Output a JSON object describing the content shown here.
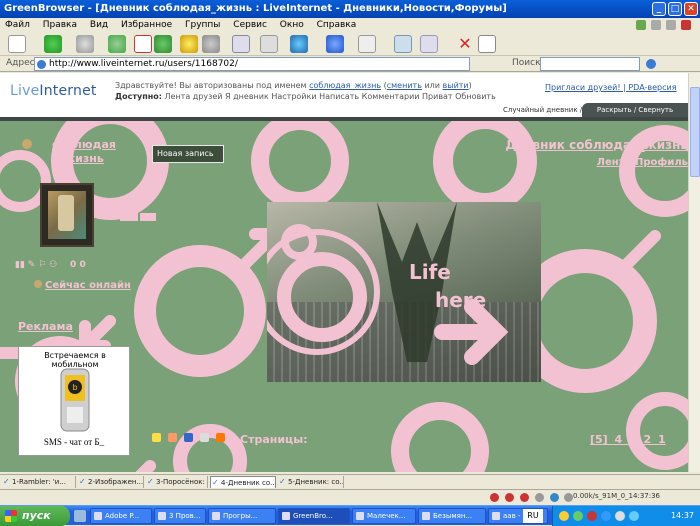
{
  "window": {
    "title": "GreenBrowser - [Дневник соблюдая_жизнь : LiveInternet - Дневники,Новости,Форумы]"
  },
  "menu": {
    "items": [
      "Файл",
      "Правка",
      "Вид",
      "Избранное",
      "Группы",
      "Сервис",
      "Окно",
      "Справка"
    ]
  },
  "address": {
    "label": "Адрес",
    "url": "http://www.liveinternet.ru/users/1168702/",
    "search_label": "Поиск:",
    "search_value": ""
  },
  "li": {
    "logo_live": "Live",
    "logo_internet": "Internet",
    "greet_prefix": "Здравствуйте! Вы авторизованы под именем ",
    "greet_user": "соблюдая_жизнь",
    "greet_change": "сменить",
    "greet_or": " или ",
    "greet_exit": "выйти",
    "avail_label": "Доступно:",
    "avail_items": "Лента друзей  Я дневник  Настройки  Написать  Комментарии  Приват  Обновить",
    "invite": "Пригласи друзей!",
    "pda": "PDA-версия",
    "tab_random": "Случайный дневник //",
    "tab_expand": "Раскрыть / Свернуть"
  },
  "diary": {
    "user_line1": "соблюдая",
    "user_line2": "жизнь",
    "new_post": "Новая запись",
    "title_right": "Дневник соблюдая_жизнь",
    "feed": "Лента",
    "profile": "Профиль",
    "online": "Сейчас онлайн",
    "ads": "Реклама",
    "mobile_title": "Встречаемся в мобильном",
    "mobile_caption": "SMS - чат от Б_",
    "counts": "0  0",
    "pages_label": "Страницы:",
    "pages": "[5] 4 3 2 1",
    "banner_line1": "Life",
    "banner_line2": "here"
  },
  "browser_tabs": [
    "1-Rambler: 'и...",
    "2-Изображен...",
    "3-Поросёнок:",
    "4-Дневник со...",
    "5-Дневник: со..."
  ],
  "status": {
    "right": "0.00k/s_91M_0_14:37:36"
  },
  "taskbar": {
    "start": "пуск",
    "tasks": [
      "Adobe P...",
      "3 Пров...",
      "Прогры...",
      "GreenBro...",
      "Малечек...",
      "Безымян...",
      "аав - Пр..."
    ],
    "lang": "RU",
    "clock": "14:37"
  },
  "colors": {
    "bg_green": "#7ba178",
    "pink": "#f3c2d2",
    "title_blue": "#0a5fd8"
  }
}
